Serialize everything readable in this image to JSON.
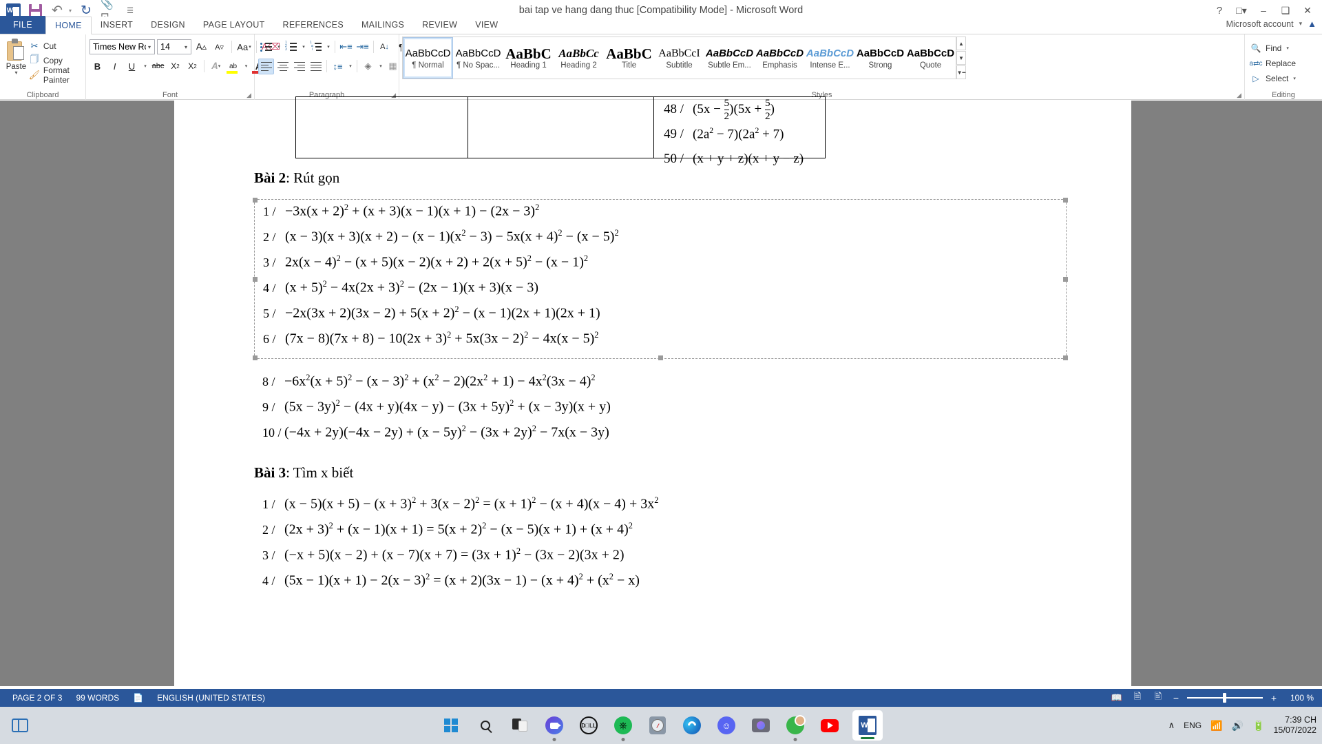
{
  "titlebar": {
    "document_title": "bai tap ve hang dang thuc [Compatibility Mode] - Microsoft Word",
    "qat": [
      {
        "name": "word-logo-icon",
        "label": "W"
      },
      {
        "name": "save-icon",
        "label": "Save"
      },
      {
        "name": "undo-icon",
        "label": "↶"
      },
      {
        "name": "redo-icon",
        "label": "↻"
      },
      {
        "name": "touch-mode-icon",
        "label": "Touch/Mouse Mode"
      },
      {
        "name": "customize-qat-icon",
        "label": "≡"
      }
    ],
    "help_label": "?",
    "ribbon_display_label": "❐",
    "minimize_label": "–",
    "restore_label": "❐",
    "close_label": "✕"
  },
  "ribbon": {
    "tabs": [
      {
        "label": "FILE",
        "active": false,
        "file": true
      },
      {
        "label": "HOME",
        "active": true
      },
      {
        "label": "INSERT",
        "active": false
      },
      {
        "label": "DESIGN",
        "active": false
      },
      {
        "label": "PAGE LAYOUT",
        "active": false
      },
      {
        "label": "REFERENCES",
        "active": false
      },
      {
        "label": "MAILINGS",
        "active": false
      },
      {
        "label": "REVIEW",
        "active": false
      },
      {
        "label": "VIEW",
        "active": false
      }
    ],
    "account": "Microsoft account",
    "groups": {
      "clipboard": {
        "label": "Clipboard",
        "paste_label": "Paste",
        "items": [
          {
            "label": "Cut",
            "icon": "scissors-icon"
          },
          {
            "label": "Copy",
            "icon": "copy-icon"
          },
          {
            "label": "Format Painter",
            "icon": "format-painter-icon"
          }
        ]
      },
      "font": {
        "label": "Font",
        "font_name": "Times New Ro",
        "font_size": "14",
        "buttons": [
          {
            "name": "grow-font",
            "label": "A"
          },
          {
            "name": "shrink-font",
            "label": "A"
          },
          {
            "name": "change-case",
            "label": "Aa"
          },
          {
            "name": "clear-formatting",
            "label": "A"
          },
          {
            "name": "bold",
            "label": "B"
          },
          {
            "name": "italic",
            "label": "I"
          },
          {
            "name": "underline",
            "label": "U"
          },
          {
            "name": "strikethrough",
            "label": "abc"
          },
          {
            "name": "subscript",
            "label": "X2"
          },
          {
            "name": "superscript",
            "label": "X2"
          },
          {
            "name": "text-effects",
            "label": "A"
          },
          {
            "name": "text-highlight-color",
            "label": "ab"
          },
          {
            "name": "font-color",
            "label": "A"
          }
        ],
        "highlight_color": "#ffff00",
        "font_color": "#e03030"
      },
      "paragraph": {
        "label": "Paragraph",
        "buttons": [
          {
            "name": "bullets"
          },
          {
            "name": "numbering"
          },
          {
            "name": "multilevel-list"
          },
          {
            "name": "decrease-indent"
          },
          {
            "name": "increase-indent"
          },
          {
            "name": "sort"
          },
          {
            "name": "show-formatting-marks"
          },
          {
            "name": "align-left"
          },
          {
            "name": "align-center"
          },
          {
            "name": "align-right"
          },
          {
            "name": "justify"
          },
          {
            "name": "line-spacing"
          },
          {
            "name": "shading"
          },
          {
            "name": "borders"
          }
        ]
      },
      "styles": {
        "label": "Styles",
        "items": [
          {
            "preview": "AaBbCcD",
            "name": "¶ Normal",
            "selected": true,
            "style": "normal"
          },
          {
            "preview": "AaBbCcD",
            "name": "¶ No Spac...",
            "selected": false,
            "style": "normal"
          },
          {
            "preview": "AaBbC",
            "name": "Heading 1",
            "selected": false,
            "style": "h1"
          },
          {
            "preview": "AaBbCc",
            "name": "Heading 2",
            "selected": false,
            "style": "h2"
          },
          {
            "preview": "AaBbC",
            "name": "Title",
            "selected": false,
            "style": "title"
          },
          {
            "preview": "AaBbCcI",
            "name": "Subtitle",
            "selected": false,
            "style": "subtitle"
          },
          {
            "preview": "AaBbCcD",
            "name": "Subtle Em...",
            "selected": false,
            "style": "subtleem"
          },
          {
            "preview": "AaBbCcD",
            "name": "Emphasis",
            "selected": false,
            "style": "emphasis"
          },
          {
            "preview": "AaBbCcD",
            "name": "Intense E...",
            "selected": false,
            "style": "intense"
          },
          {
            "preview": "AaBbCcD",
            "name": "Strong",
            "selected": false,
            "style": "strong"
          },
          {
            "preview": "AaBbCcD",
            "name": "Quote",
            "selected": false,
            "style": "quote"
          }
        ],
        "nav_up": "▲",
        "nav_down": "▼",
        "nav_more": "▬"
      },
      "editing": {
        "label": "Editing",
        "items": [
          {
            "label": "Find",
            "icon": "find-icon",
            "caret": true
          },
          {
            "label": "Replace",
            "icon": "replace-icon",
            "caret": false
          },
          {
            "label": "Select",
            "icon": "select-icon",
            "caret": true
          }
        ]
      }
    }
  },
  "document": {
    "table_rows": [
      {
        "num": "48 /",
        "expr": "(5x − 5/2)(5x + 5/2)"
      },
      {
        "num": "49 /",
        "expr": "(2a² − 7)(2a² + 7)"
      },
      {
        "num": "50 /",
        "expr": "(x + y + z)(x + y − z)"
      }
    ],
    "heading_bai2_bold": "Bài 2",
    "heading_bai2_rest": ": Rút gọn",
    "heading_bai3_bold": "Bài 3",
    "heading_bai3_rest": ": Tìm x biết",
    "bai2_selected": [
      {
        "num": "1 /",
        "expr": "−3x(x + 2)² + (x + 3)(x − 1)(x + 1) − (2x − 3)²"
      },
      {
        "num": "2 /",
        "expr": "(x − 3)(x + 3)(x + 2) − (x − 1)(x² − 3) − 5x(x + 4)² − (x − 5)²"
      },
      {
        "num": "3 /",
        "expr": "2x(x − 4)² − (x + 5)(x − 2)(x + 2) + 2(x + 5)² − (x − 1)²"
      },
      {
        "num": "4 /",
        "expr": "(x + 5)² − 4x(2x + 3)² − (2x − 1)(x + 3)(x − 3)"
      },
      {
        "num": "5 /",
        "expr": "−2x(3x + 2)(3x − 2) + 5(x + 2)² − (x − 1)(2x + 1)(2x + 1)"
      },
      {
        "num": "6 /",
        "expr": "(7x − 8)(7x + 8) − 10(2x + 3)² + 5x(3x − 2)² − 4x(x − 5)²"
      }
    ],
    "bai2_rest": [
      {
        "num": "8 /",
        "expr": "−6x²(x + 5)² − (x − 3)² + (x² − 2)(2x² + 1) − 4x²(3x − 4)²"
      },
      {
        "num": "9 /",
        "expr": "(5x − 3y)² − (4x + y)(4x − y) − (3x + 5y)² + (x − 3y)(x + y)"
      },
      {
        "num": "10 /",
        "expr": "(−4x + 2y)(−4x − 2y) + (x − 5y)² − (3x + 2y)² − 7x(x − 3y)"
      }
    ],
    "bai3": [
      {
        "num": "1 /",
        "expr": "(x − 5)(x + 5) − (x + 3)² + 3(x − 2)² = (x + 1)² − (x + 4)(x − 4) + 3x²"
      },
      {
        "num": "2 /",
        "expr": "(2x + 3)² + (x − 1)(x + 1) = 5(x + 2)² − (x − 5)(x + 1) + (x + 4)²"
      },
      {
        "num": "3 /",
        "expr": "(−x + 5)(x − 2) + (x − 7)(x + 7) = (3x + 1)² − (3x − 2)(3x + 2)"
      },
      {
        "num": "4 /",
        "expr": "(5x − 1)(x + 1) − 2(x − 3)² = (x + 2)(3x − 1) − (x + 4)² + (x² − x)"
      }
    ]
  },
  "statusbar": {
    "page": "PAGE 2 OF 3",
    "words": "99 WORDS",
    "proofing_icon": "spell-check-icon",
    "language": "ENGLISH (UNITED STATES)",
    "view_read": "read-mode-icon",
    "view_print": "print-layout-icon",
    "view_web": "web-layout-icon",
    "zoom_out": "−",
    "zoom_in": "+",
    "zoom_level": "100 %"
  },
  "taskbar": {
    "apps": [
      {
        "name": "widgets-icon",
        "label": "Widgets"
      },
      {
        "name": "start-icon",
        "label": "Start"
      },
      {
        "name": "search-icon",
        "label": "Search"
      },
      {
        "name": "task-view-icon",
        "label": "Task View"
      },
      {
        "name": "zoom-meetings-icon",
        "label": "Zoom"
      },
      {
        "name": "dell-icon",
        "label": "Dell"
      },
      {
        "name": "spotify-icon",
        "label": "Spotify"
      },
      {
        "name": "clock-icon",
        "label": "Alarms & Clock"
      },
      {
        "name": "edge-icon",
        "label": "Microsoft Edge"
      },
      {
        "name": "discord-icon",
        "label": "Discord"
      },
      {
        "name": "camera-icon",
        "label": "Camera"
      },
      {
        "name": "profile-icon",
        "label": "Profile"
      },
      {
        "name": "youtube-icon",
        "label": "YouTube"
      },
      {
        "name": "word-taskbar-icon",
        "label": "Microsoft Word"
      }
    ],
    "show_hidden": "∧",
    "language": "ENG",
    "wifi_icon": "wifi-icon",
    "volume_icon": "volume-icon",
    "battery_icon": "battery-icon",
    "time": "7:39 CH",
    "date": "15/07/2022"
  }
}
